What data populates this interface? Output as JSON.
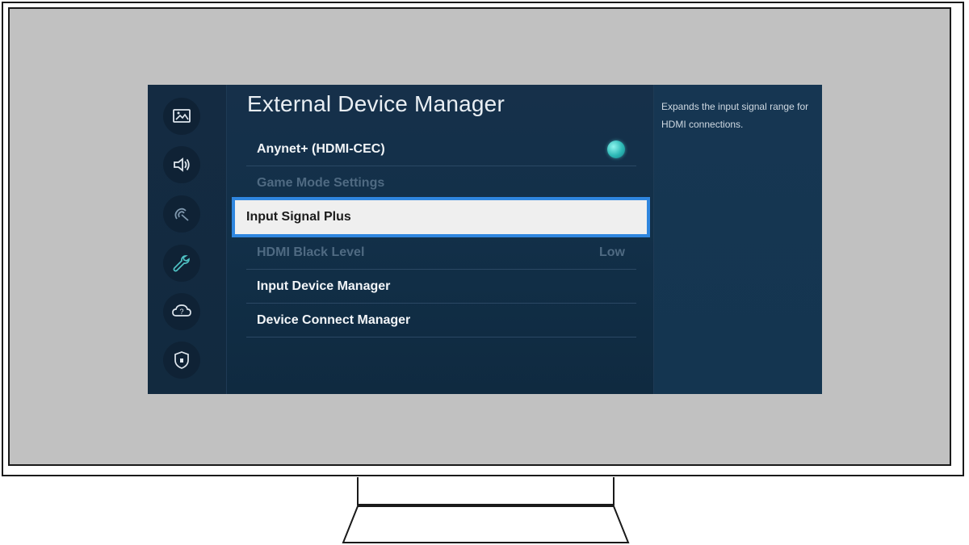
{
  "screen": {
    "title": "External Device Manager",
    "help_text": "Expands the input signal range for HDMI connections.",
    "sidebar": {
      "icons": [
        "picture-icon",
        "sound-icon",
        "broadcasting-icon",
        "general-icon",
        "support-icon",
        "privacy-icon"
      ]
    },
    "menu": [
      {
        "label": "Anynet+ (HDMI-CEC)",
        "state": "on"
      },
      {
        "label": "Game Mode Settings",
        "state": "disabled"
      },
      {
        "label": "Input Signal Plus",
        "state": "focused"
      },
      {
        "label": "HDMI Black Level",
        "value": "Low",
        "state": "disabled"
      },
      {
        "label": "Input Device Manager",
        "state": "normal"
      },
      {
        "label": "Device Connect Manager",
        "state": "normal"
      }
    ],
    "colors": {
      "focus_border": "#2f86df",
      "toggle_on": "#2cb8b5",
      "background": "#123049"
    }
  }
}
